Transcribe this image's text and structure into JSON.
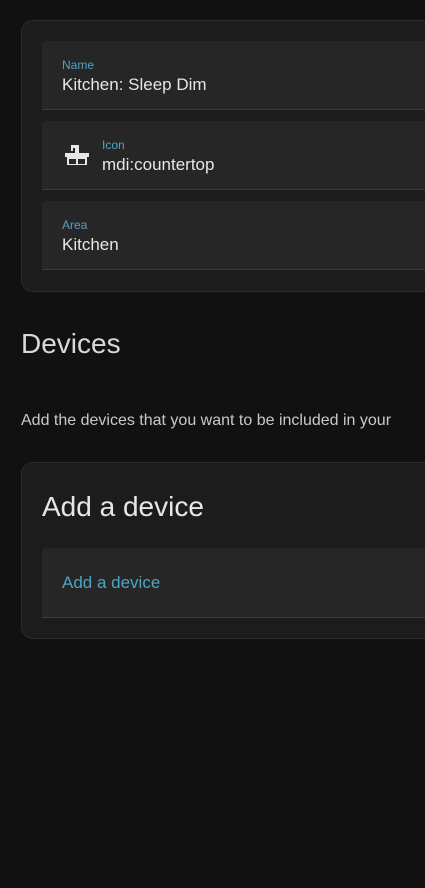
{
  "details": {
    "name": {
      "label": "Name",
      "value": "Kitchen: Sleep Dim"
    },
    "icon": {
      "label": "Icon",
      "value": "mdi:countertop",
      "icon_name": "countertop-icon"
    },
    "area": {
      "label": "Area",
      "value": "Kitchen"
    }
  },
  "devices": {
    "title": "Devices",
    "description": "Add the devices that you want to be included in your",
    "add_card": {
      "title": "Add a device",
      "picker_placeholder": "Add a device"
    }
  },
  "colors": {
    "background": "#111111",
    "card": "#1c1c1c",
    "field": "#262626",
    "accent": "#4da4c4"
  }
}
